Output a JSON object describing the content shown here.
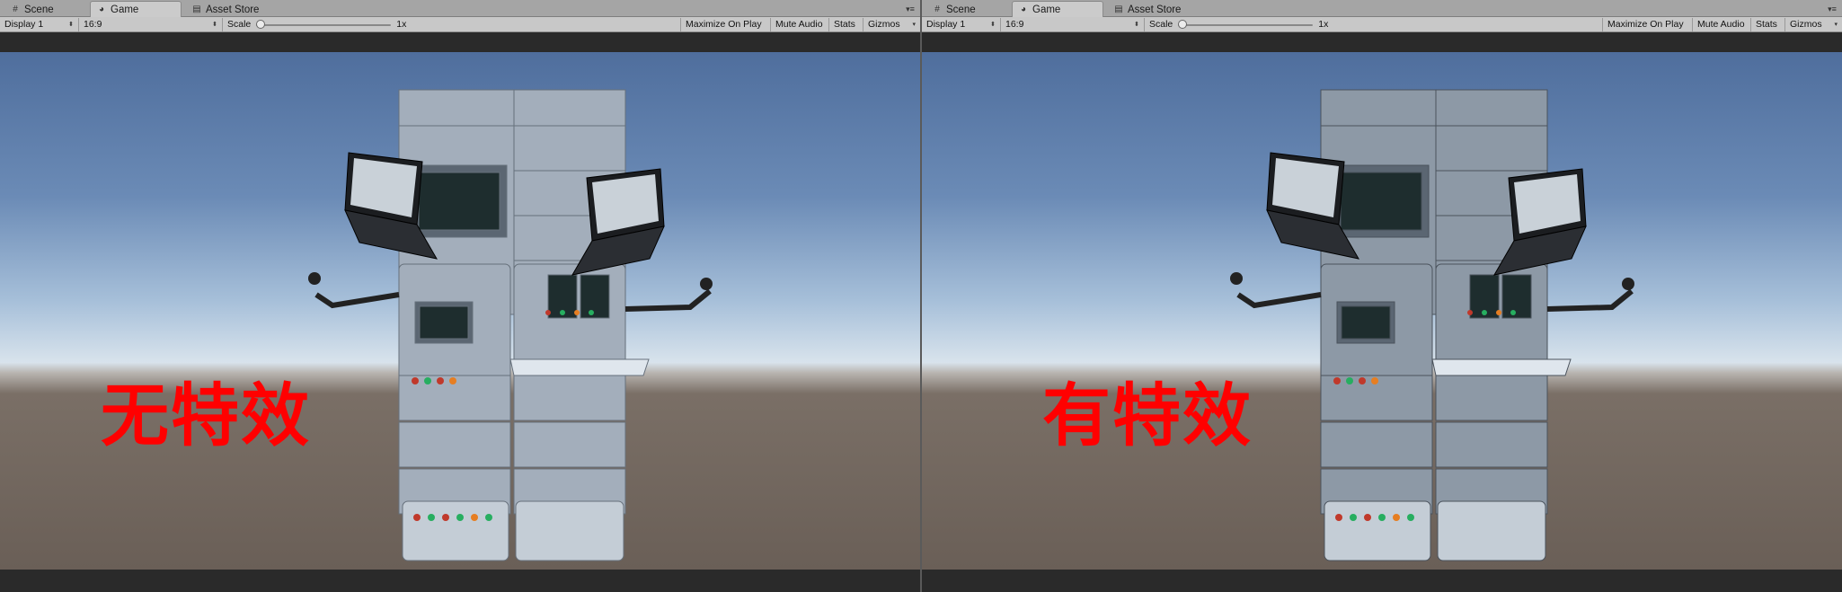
{
  "panels": [
    {
      "tabs": [
        {
          "label": "Scene",
          "icon": "grid-icon"
        },
        {
          "label": "Game",
          "icon": "game-icon",
          "active": true
        },
        {
          "label": "Asset Store",
          "icon": "store-icon"
        }
      ],
      "toolbar": {
        "display": "Display 1",
        "aspect": "16:9",
        "scale_label": "Scale",
        "scale_value": "1x",
        "maximize": "Maximize On Play",
        "mute": "Mute Audio",
        "stats": "Stats",
        "gizmos": "Gizmos"
      },
      "overlay_text": "无特效"
    },
    {
      "tabs": [
        {
          "label": "Scene",
          "icon": "grid-icon"
        },
        {
          "label": "Game",
          "icon": "game-icon",
          "active": true
        },
        {
          "label": "Asset Store",
          "icon": "store-icon"
        }
      ],
      "toolbar": {
        "display": "Display 1",
        "aspect": "16:9",
        "scale_label": "Scale",
        "scale_value": "1x",
        "maximize": "Maximize On Play",
        "mute": "Mute Audio",
        "stats": "Stats",
        "gizmos": "Gizmos"
      },
      "overlay_text": "有特效"
    }
  ],
  "colors": {
    "overlay_text": "#ff0000",
    "sky_top": "#4f6e9d",
    "horizon": "#d8e3ec",
    "ground": "#6a5f57",
    "cabinet": "#9aa6b2"
  }
}
